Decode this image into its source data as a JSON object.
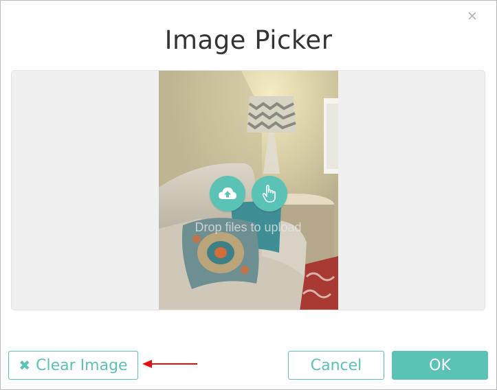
{
  "dialog": {
    "title": "Image Picker",
    "close_icon": "close-icon"
  },
  "drop_area": {
    "hint": "Drop files to upload",
    "upload_icon": "cloud-upload-icon",
    "pick_icon": "hand-pointer-icon",
    "accent_color": "#5bc2b6"
  },
  "footer": {
    "clear_label": "Clear Image",
    "clear_icon": "times-icon",
    "cancel_label": "Cancel",
    "ok_label": "OK"
  },
  "annotation": {
    "arrow_color": "#e01010"
  }
}
